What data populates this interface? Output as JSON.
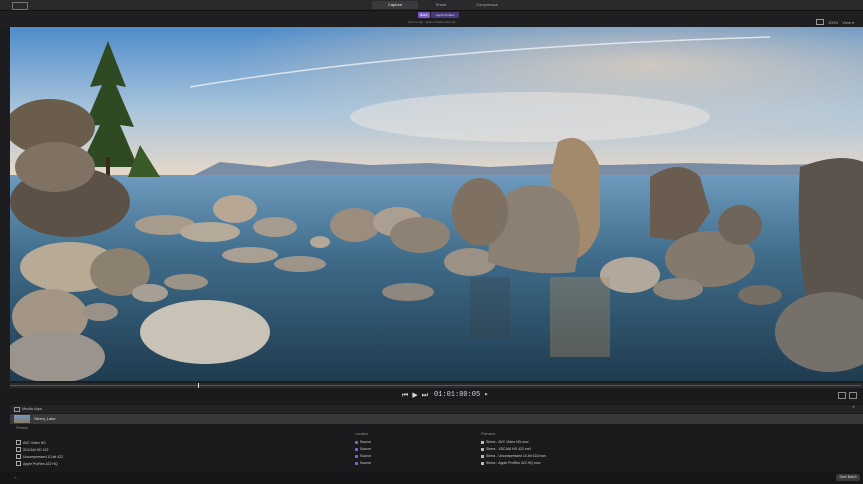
{
  "tabs": [
    {
      "label": "Capture",
      "selected": true
    },
    {
      "label": "Share",
      "selected": false
    },
    {
      "label": "Compressor",
      "selected": false
    }
  ],
  "toggles": {
    "a": "Batch",
    "b": "Apple ProRes"
  },
  "media_info": "Source clip · Apple ProRes 422 HQ",
  "view": {
    "zoom": "100%",
    "view_label": "View ▾"
  },
  "transport": {
    "prev": "⏮",
    "play": "▶",
    "next": "⏭",
    "timecode": "01:01:00:05 ▸"
  },
  "playhead_fraction": 0.22,
  "panel": {
    "title": "Media clips",
    "close": "×",
    "clip_name": "Sierra_Lake",
    "columns": {
      "presets": "Presets",
      "location": "Location",
      "filename": "Filename"
    },
    "rows": [
      {
        "preset": "AVC Video HD",
        "location": "Source",
        "filename": "Sierra - AVC Video HD.mov"
      },
      {
        "preset": "XDCAM HD 422",
        "location": "Source",
        "filename": "Sierra - XDCAM HD 422.mxf"
      },
      {
        "preset": "Uncompressed 10-bit 422",
        "location": "Source",
        "filename": "Sierra - Uncompressed 10-bit 422.mov"
      },
      {
        "preset": "Apple ProRes 422 HQ",
        "location": "Source",
        "filename": "Sierra - Apple ProRes 422 HQ.mov"
      }
    ]
  },
  "footer": {
    "left": "+ -",
    "start_button": "Start Batch"
  },
  "colors": {
    "accent": "#7a5cc7",
    "background": "#1d1d1f"
  }
}
